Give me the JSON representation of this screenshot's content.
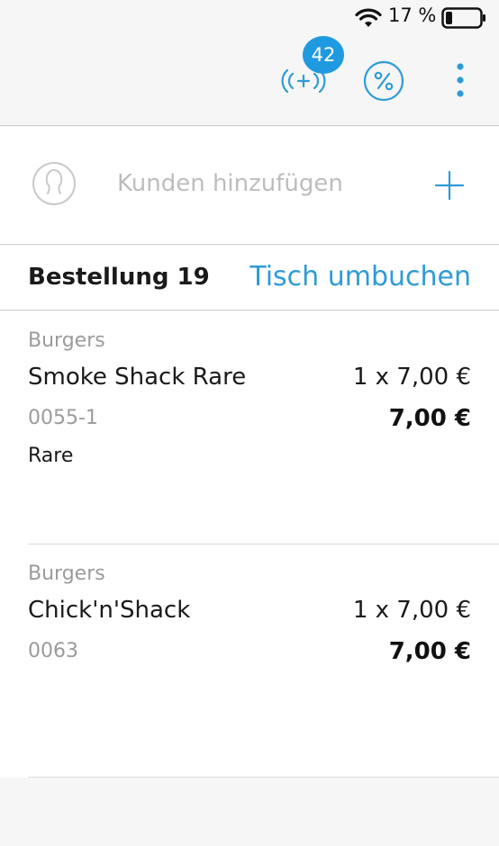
{
  "status_bar": {
    "battery_percent": "17 %",
    "icons": [
      "wifi-icon",
      "battery-icon"
    ]
  },
  "toolbar": {
    "sync_badge": "42",
    "icons": [
      "sync-icon",
      "discount-icon",
      "more-vertical-icon"
    ]
  },
  "customer": {
    "placeholder": "Kunden hinzufügen",
    "icons": [
      "avatar-icon",
      "plus-icon"
    ]
  },
  "order": {
    "title": "Bestellung 19",
    "rebook_label": "Tisch umbuchen"
  },
  "items": [
    {
      "category": "Burgers",
      "name": "Smoke Shack Rare",
      "quantity_price": "1 x 7,00 €",
      "sku": "0055-1",
      "total": "7,00 €",
      "modifier": "Rare"
    },
    {
      "category": "Burgers",
      "name": "Chick'n'Shack",
      "quantity_price": "1 x 7,00 €",
      "sku": "0063",
      "total": "7,00 €",
      "modifier": ""
    }
  ],
  "colors": {
    "accent": "#2e9bd6",
    "badge": "#1f9ae0",
    "background": "#f6f6f6"
  }
}
